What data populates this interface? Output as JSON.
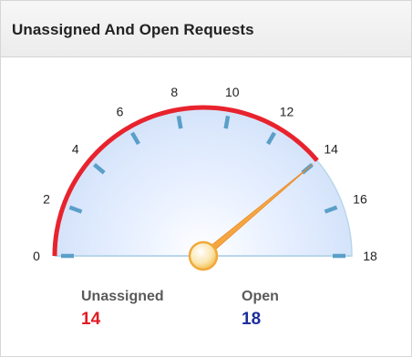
{
  "widget": {
    "title": "Unassigned And Open Requests"
  },
  "gauge": {
    "min": 0,
    "max": 18,
    "tick_labels": [
      "0",
      "2",
      "4",
      "6",
      "8",
      "10",
      "12",
      "14",
      "16",
      "18"
    ],
    "needle_value": 14,
    "red_band_range": [
      0,
      14
    ],
    "colors": {
      "band": "#e8232d",
      "needle": "#f5a640",
      "ticks": "#5a9fc9",
      "face": "#dde9fb",
      "edge": "#b9d6ea"
    }
  },
  "legend": {
    "unassigned": {
      "label": "Unassigned",
      "value": "14",
      "color": "#e11b22"
    },
    "open": {
      "label": "Open",
      "value": "18",
      "color": "#1b2f9c"
    }
  }
}
